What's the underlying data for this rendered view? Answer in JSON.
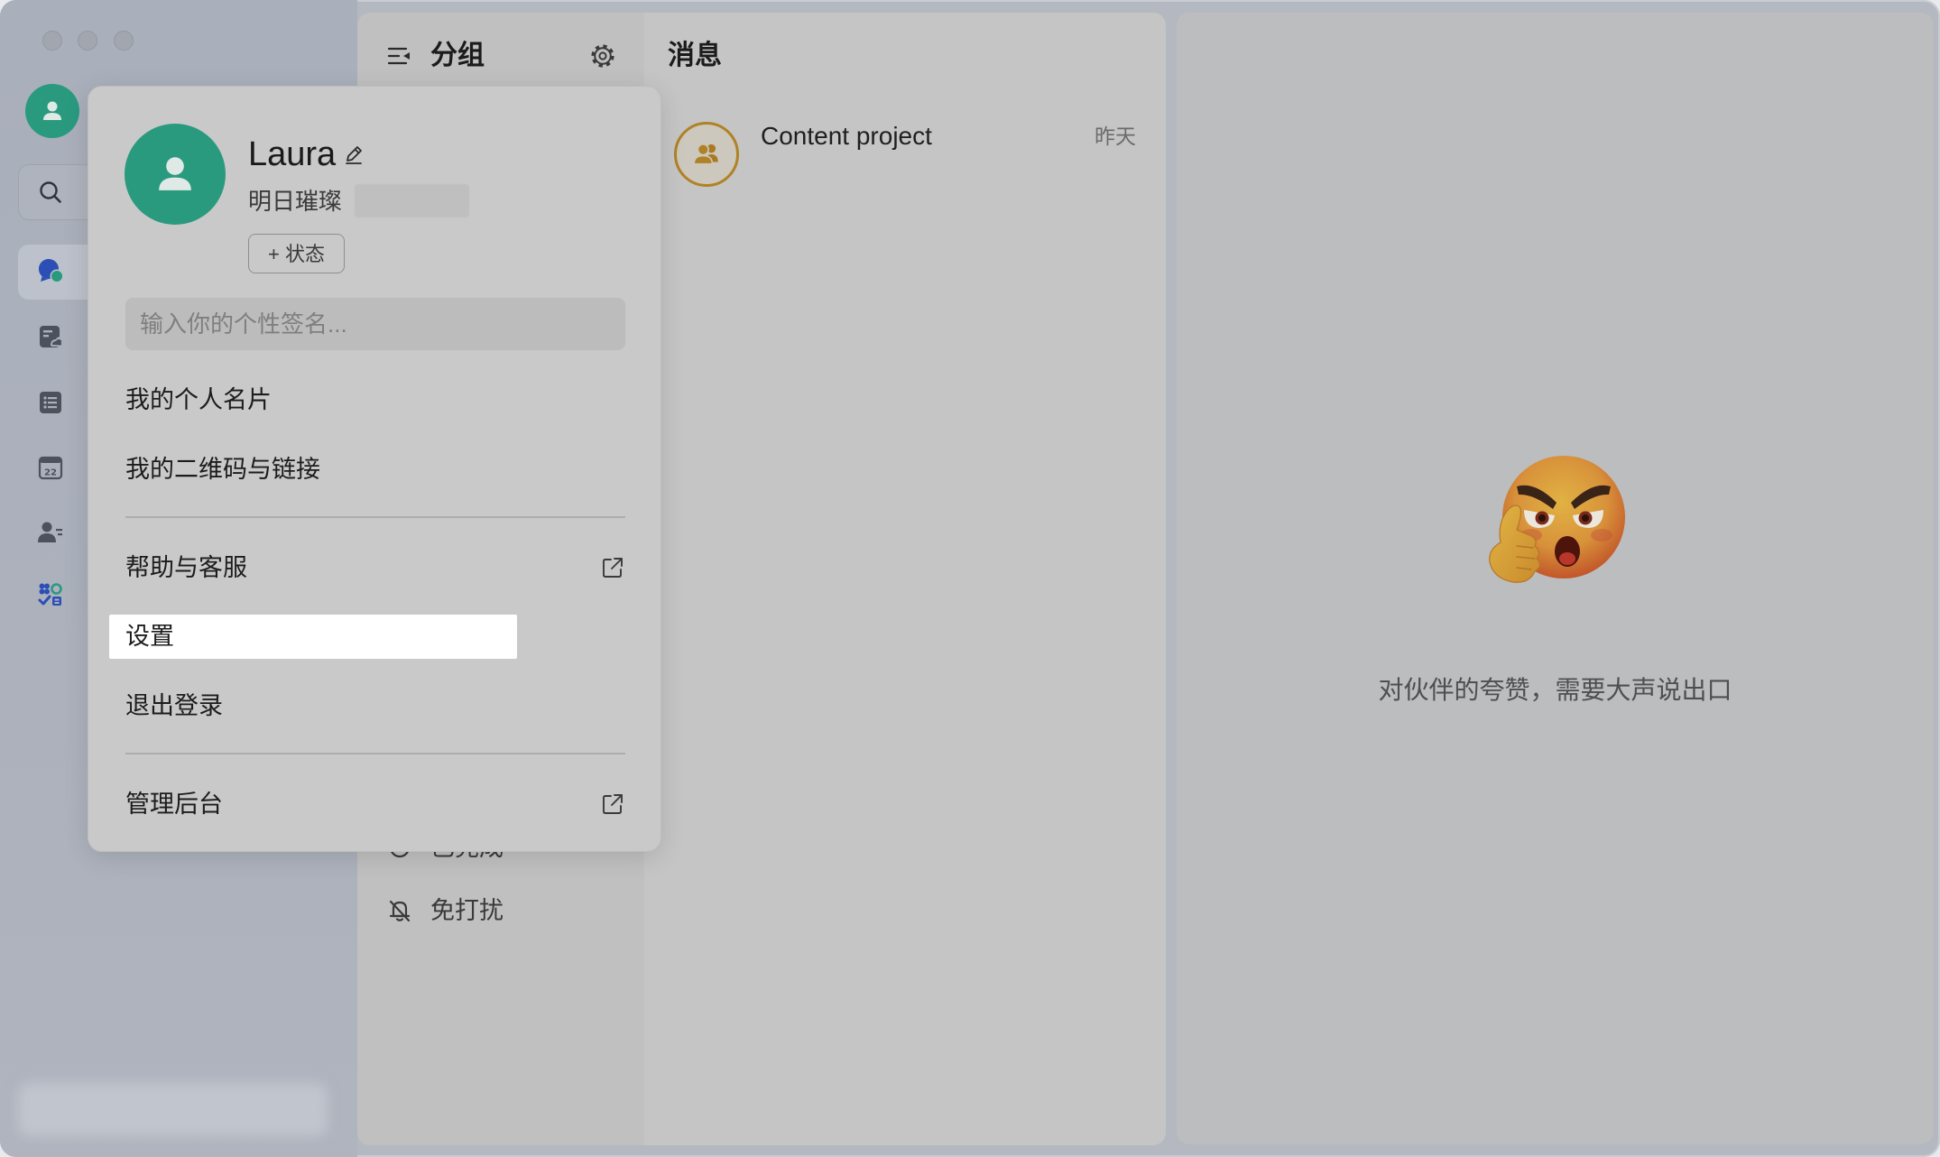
{
  "window": {
    "traffic_lights": [
      "close-dot",
      "minimize-dot",
      "zoom-dot"
    ]
  },
  "sidebar": {
    "avatar_icon": "user-icon",
    "search_icon": "search-icon",
    "nav": [
      {
        "icon": "messages-icon",
        "selected": true
      },
      {
        "icon": "docs-icon",
        "selected": false
      },
      {
        "icon": "list-icon",
        "selected": false
      },
      {
        "icon": "calendar-icon",
        "selected": false,
        "badge": "22"
      },
      {
        "icon": "contacts-icon",
        "selected": false
      },
      {
        "icon": "apps-icon",
        "selected": false
      }
    ]
  },
  "groups_panel": {
    "title": "分组",
    "header_icon": "collapse-panel-icon",
    "settings_icon": "gear-icon",
    "items": [
      {
        "label": "已完成",
        "icon": "done-icon"
      },
      {
        "label": "免打扰",
        "icon": "bell-off-icon"
      }
    ]
  },
  "messages_panel": {
    "title": "消息",
    "chats": [
      {
        "title": "Content project",
        "time": "昨天",
        "avatar_icon": "group-icon"
      }
    ]
  },
  "detail_panel": {
    "emoji": "thumb-chin-emoji",
    "empty_text": "对伙伴的夸赞，需要大声说出口"
  },
  "profile_popup": {
    "avatar_icon": "user-icon",
    "name": "Laura",
    "edit_icon": "pencil-icon",
    "org": "明日璀璨",
    "status_button": "+ 状态",
    "signature_placeholder": "输入你的个性签名...",
    "menu": [
      {
        "label": "我的个人名片"
      },
      {
        "label": "我的二维码与链接"
      },
      {
        "label": "帮助与客服",
        "icon": "external-link-icon"
      },
      {
        "label": "设置",
        "highlighted": true
      },
      {
        "label": "退出登录"
      },
      {
        "label": "管理后台",
        "icon": "external-link-icon"
      }
    ]
  },
  "colors": {
    "accent_green": "#2a9a7f",
    "message_blue": "#2c4fb5",
    "chat_avatar_ring": "#b08226",
    "highlight": "#ffffff"
  }
}
